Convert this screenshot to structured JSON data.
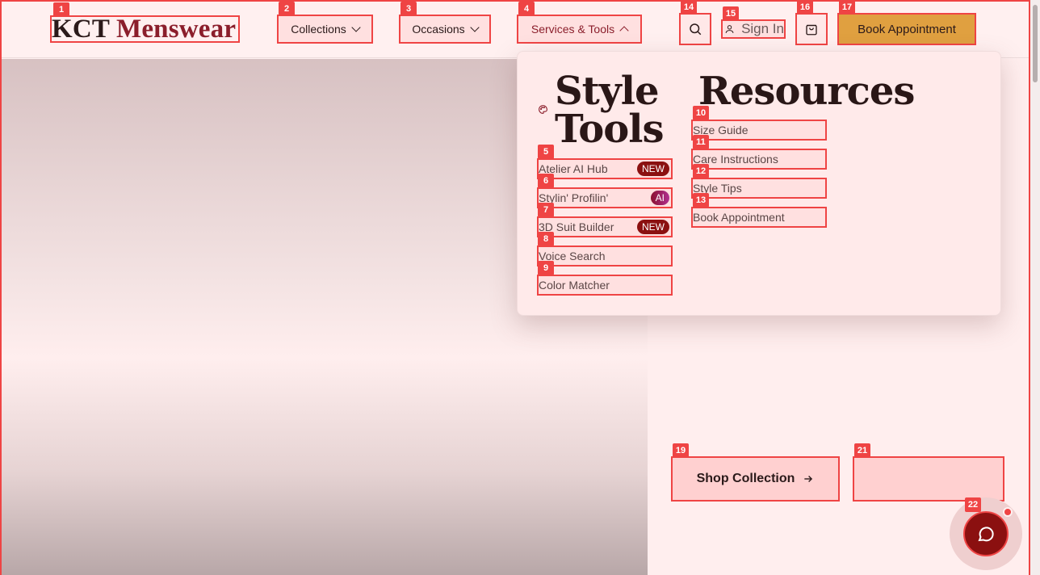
{
  "brand": {
    "part1": "KCT",
    "part2": "Menswear"
  },
  "nav": {
    "collections": "Collections",
    "occasions": "Occasions",
    "services": "Services & Tools"
  },
  "header": {
    "sign_in": "Sign In",
    "book": "Book Appointment"
  },
  "dropdown": {
    "style_tools": {
      "title_line1": "Style",
      "title_line2": "Tools",
      "icon": "palette-icon",
      "items": [
        {
          "label": "Atelier AI Hub",
          "badge": "NEW"
        },
        {
          "label": "Stylin' Profilin'",
          "badge": "AI"
        },
        {
          "label": "3D Suit Builder",
          "badge": "NEW"
        },
        {
          "label": "Voice Search",
          "badge": ""
        },
        {
          "label": "Color Matcher",
          "badge": ""
        }
      ]
    },
    "resources": {
      "title": "Resources",
      "items": [
        {
          "label": "Size Guide"
        },
        {
          "label": "Care Instructions"
        },
        {
          "label": "Style Tips"
        },
        {
          "label": "Book Appointment"
        }
      ]
    }
  },
  "hero": {
    "shop_collection": "Shop Collection",
    "secondary_cta": ""
  },
  "tags": [
    "1",
    "2",
    "3",
    "4",
    "5",
    "6",
    "7",
    "8",
    "9",
    "10",
    "11",
    "12",
    "13",
    "14",
    "15",
    "16",
    "17",
    "19",
    "21",
    "22"
  ],
  "colors": {
    "accent": "#8b1e2b",
    "book_button": "#e0a040",
    "annotation": "#ef4444"
  }
}
